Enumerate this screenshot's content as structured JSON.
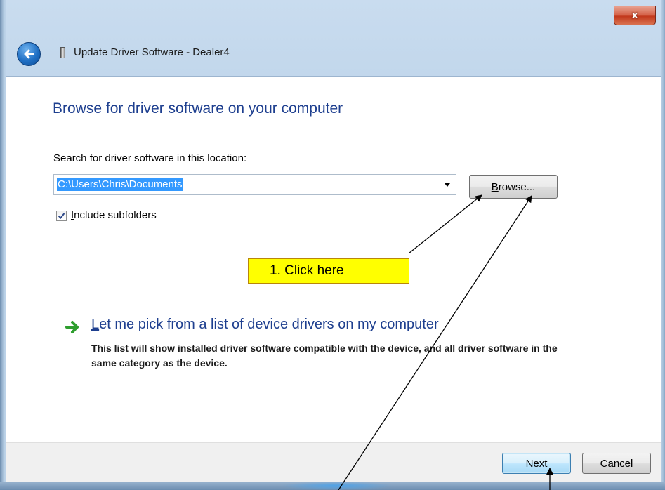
{
  "window": {
    "title": "Update Driver Software - Dealer4",
    "close_glyph": "x"
  },
  "page": {
    "heading": "Browse for driver software on your computer",
    "search_label": "Search for driver software in this location:",
    "path_value": "C:\\Users\\Chris\\Documents",
    "browse_button": {
      "mnemonic": "B",
      "label_rest": "rowse..."
    },
    "include_subfolders": {
      "mnemonic": "I",
      "label_rest": "nclude subfolders",
      "checked": true
    }
  },
  "pick_option": {
    "mnemonic": "L",
    "label_rest": "et me pick from a list of device drivers on my computer",
    "description": "This list will show installed driver software compatible with the device, and all driver software in the same category as the device."
  },
  "footer": {
    "next_button": {
      "pre": "Ne",
      "mnemonic": "x",
      "post": "t"
    },
    "cancel_button": "Cancel"
  },
  "annotation": {
    "callout_text": "1. Click here"
  },
  "colors": {
    "heading_blue": "#1e3f8f",
    "selection_blue": "#3399ff",
    "callout_yellow": "#ffff00",
    "close_red": "#c2391c",
    "arrow_green": "#2e9e2e"
  },
  "icons": [
    "close-icon",
    "back-arrow-icon",
    "device-icon",
    "checkmark-icon",
    "green-arrow-icon",
    "combo-dropdown-icon"
  ]
}
